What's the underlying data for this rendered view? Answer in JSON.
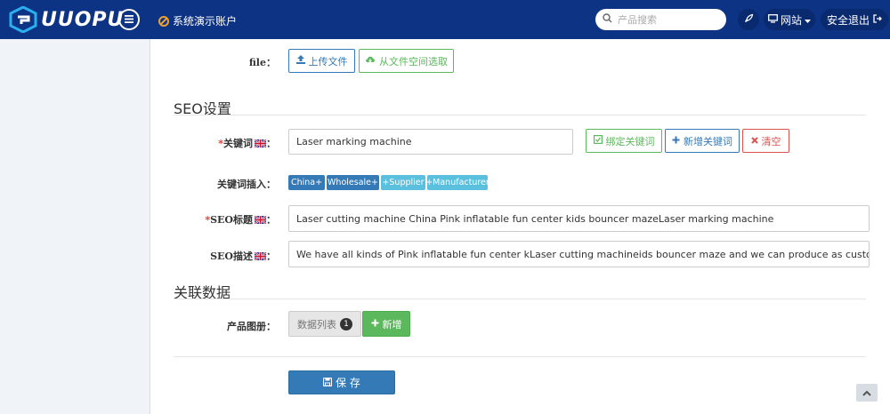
{
  "header": {
    "logo_text": "UUOPU",
    "account_label": "系统演示账户",
    "search_placeholder": "产品搜索",
    "site_menu_label": "网站",
    "logout_label": "安全退出"
  },
  "file_row": {
    "label": "file：",
    "upload_label": "上传文件",
    "choose_label": "从文件空间选取"
  },
  "seo": {
    "title": "SEO设置",
    "keywords_label": "关键词",
    "keywords_value": "Laser marking machine",
    "bind_label": "绑定关键词",
    "new_label": "新增关键词",
    "clear_label": "清空",
    "insert_label": "关键词插入：",
    "tags": [
      "China+",
      "Wholesale+",
      "+Supplier",
      "+Manufacturer"
    ],
    "seo_title_label": "SEO标题",
    "seo_title_value": "Laser cutting machine China Pink inflatable fun center kids bouncer mazeLaser marking machine",
    "seo_desc_label": "SEO描述",
    "seo_desc_value": "We have all kinds of Pink inflatable fun center kLaser cutting machineids bouncer maze and we can produce as customer design, Pink inflatable fun cer"
  },
  "related": {
    "title": "关联数据",
    "album_label": "产品图册：",
    "list_label": "数据列表",
    "list_count": "1",
    "add_label": "新增"
  },
  "actions": {
    "save_label": "保 存"
  },
  "colors": {
    "topbar": "#0d3384",
    "primary": "#337ab7",
    "success": "#5cb85c",
    "danger": "#d9534f",
    "info": "#5bc0de"
  }
}
